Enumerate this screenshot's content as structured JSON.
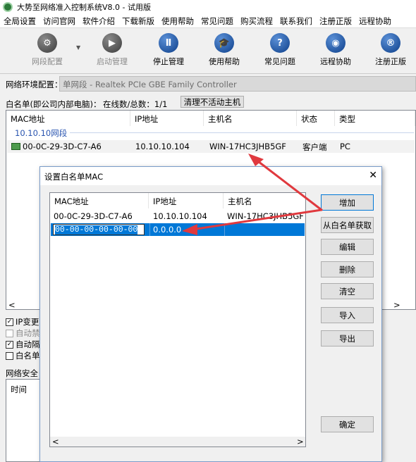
{
  "window": {
    "title": "大势至网络准入控制系统V8.0 - 试用版"
  },
  "menu": [
    "全局设置",
    "访问官网",
    "软件介绍",
    "下载新版",
    "使用帮助",
    "常见问题",
    "购买流程",
    "联系我们",
    "注册正版",
    "远程协助"
  ],
  "toolbar": {
    "items": [
      {
        "label": "网段配置",
        "icon": "gear-icon",
        "glyph": "⚙"
      },
      {
        "label": "启动管理",
        "icon": "play-icon",
        "glyph": "▶"
      },
      {
        "label": "停止管理",
        "icon": "pause-icon",
        "glyph": "Ⅱ"
      },
      {
        "label": "使用帮助",
        "icon": "graduation-cap-icon",
        "glyph": "🎓"
      },
      {
        "label": "常见问题",
        "icon": "question-icon",
        "glyph": "?"
      },
      {
        "label": "远程协助",
        "icon": "globe-icon",
        "glyph": "◉"
      },
      {
        "label": "注册正版",
        "icon": "registered-icon",
        "glyph": "®"
      }
    ],
    "dropdown_glyph": "▼"
  },
  "env": {
    "label": "网络环境配置：",
    "value": "单网段 - Realtek PCIe GBE Family Controller"
  },
  "whitelist": {
    "info": "白名单(即公司内部电脑)：",
    "count": "在线数/总数：1/1",
    "clear_button": "清理不活动主机",
    "columns": [
      "MAC地址",
      "IP地址",
      "主机名",
      "状态",
      "类型"
    ],
    "group": "10.10.10网段",
    "rows": [
      {
        "mac": "00-0C-29-3D-C7-A6",
        "ip": "10.10.10.104",
        "host": "WIN-17HC3JHB5GF",
        "status": "客户端",
        "type": "PC"
      }
    ]
  },
  "options": [
    {
      "label": "IP变更时",
      "checked": true,
      "enabled": true
    },
    {
      "label": "自动禁用",
      "checked": false,
      "enabled": false
    },
    {
      "label": "自动隔离",
      "checked": true,
      "enabled": true
    },
    {
      "label": "白名单时",
      "checked": false,
      "enabled": true
    }
  ],
  "check_glyph": "✓",
  "security": {
    "label": "网络安全日",
    "time_header": "时间"
  },
  "dialog": {
    "title": "设置白名单MAC",
    "close_glyph": "✕",
    "columns": [
      "MAC地址",
      "IP地址",
      "主机名"
    ],
    "rows": [
      {
        "mac": "00-0C-29-3D-C7-A6",
        "ip": "10.10.10.104",
        "host": "WIN-17HC3JHB5GF"
      }
    ],
    "edit_row": {
      "mac": "00-00-00-00-00-00",
      "ip": "0.0.0.0"
    },
    "buttons": {
      "add": "增加",
      "from_whitelist": "从白名单获取",
      "edit": "编辑",
      "delete": "删除",
      "clear": "清空",
      "import": "导入",
      "export": "导出",
      "ok": "确定"
    }
  },
  "scroll": {
    "left": "<",
    "right": ">"
  },
  "colors": {
    "arrow": "#e0393e",
    "selection": "#0078d7",
    "group_text": "#2a55b0"
  }
}
